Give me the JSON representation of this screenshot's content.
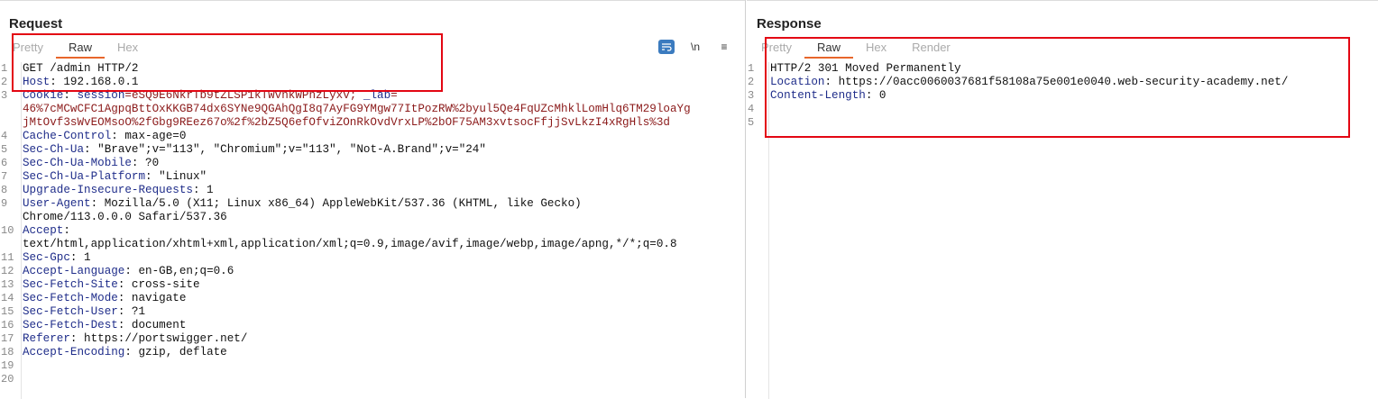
{
  "request": {
    "title": "Request",
    "tabs": [
      "Pretty",
      "Raw",
      "Hex"
    ],
    "active_tab": "Raw",
    "toolbar": [
      {
        "icon": "wrap-lines-icon",
        "glyph": "≡"
      },
      {
        "icon": "newline-icon",
        "glyph": "\\n"
      },
      {
        "icon": "menu-icon",
        "glyph": "≡"
      }
    ],
    "lines": [
      {
        "n": "1",
        "rows": [
          [
            {
              "t": "GET /admin HTTP/2",
              "c": ""
            }
          ]
        ]
      },
      {
        "n": "2",
        "rows": [
          [
            {
              "t": "Host",
              "c": "hdr"
            },
            {
              "t": ": 192.168.0.1",
              "c": ""
            }
          ]
        ]
      },
      {
        "n": "3",
        "rows": [
          [
            {
              "t": "Cookie",
              "c": "hdr"
            },
            {
              "t": ": ",
              "c": ""
            },
            {
              "t": "session",
              "c": "hdr"
            },
            {
              "t": "=eSQ9E6NkrTb9tZLSP1kTWvnkWPnzLyxv; ",
              "c": "cookie"
            },
            {
              "t": "_lab",
              "c": "hdr"
            },
            {
              "t": "=",
              "c": "cookie"
            }
          ],
          [
            {
              "t": "46%7cMCwCFC1AgpqBttOxKKGB74dx6SYNe9QGAhQgI8q7AyFG9YMgw77ItPozRW%2byul5Qe4FqUZcMhklLomHlq6TM29loaYg",
              "c": "cookie"
            }
          ],
          [
            {
              "t": "jMtOvf3sWvEOMsoO%2fGbg9REez67o%2f%2bZ5Q6efOfviZOnRkOvdVrxLP%2bOF75AM3xvtsocFfjjSvLkzI4xRgHls%3d",
              "c": "cookie"
            }
          ]
        ]
      },
      {
        "n": "4",
        "rows": [
          [
            {
              "t": "Cache-Control",
              "c": "hdr"
            },
            {
              "t": ": max-age=0",
              "c": ""
            }
          ]
        ]
      },
      {
        "n": "5",
        "rows": [
          [
            {
              "t": "Sec-Ch-Ua",
              "c": "hdr"
            },
            {
              "t": ": \"Brave\";v=\"113\", \"Chromium\";v=\"113\", \"Not-A.Brand\";v=\"24\"",
              "c": ""
            }
          ]
        ]
      },
      {
        "n": "6",
        "rows": [
          [
            {
              "t": "Sec-Ch-Ua-Mobile",
              "c": "hdr"
            },
            {
              "t": ": ?0",
              "c": ""
            }
          ]
        ]
      },
      {
        "n": "7",
        "rows": [
          [
            {
              "t": "Sec-Ch-Ua-Platform",
              "c": "hdr"
            },
            {
              "t": ": \"Linux\"",
              "c": ""
            }
          ]
        ]
      },
      {
        "n": "8",
        "rows": [
          [
            {
              "t": "Upgrade-Insecure-Requests",
              "c": "hdr"
            },
            {
              "t": ": 1",
              "c": ""
            }
          ]
        ]
      },
      {
        "n": "9",
        "rows": [
          [
            {
              "t": "User-Agent",
              "c": "hdr"
            },
            {
              "t": ": Mozilla/5.0 (X11; Linux x86_64) AppleWebKit/537.36 (KHTML, like Gecko)",
              "c": ""
            }
          ],
          [
            {
              "t": "Chrome/113.0.0.0 Safari/537.36",
              "c": ""
            }
          ]
        ]
      },
      {
        "n": "10",
        "rows": [
          [
            {
              "t": "Accept",
              "c": "hdr"
            },
            {
              "t": ":",
              "c": ""
            }
          ],
          [
            {
              "t": "text/html,application/xhtml+xml,application/xml;q=0.9,image/avif,image/webp,image/apng,*/*;q=0.8",
              "c": ""
            }
          ]
        ]
      },
      {
        "n": "11",
        "rows": [
          [
            {
              "t": "Sec-Gpc",
              "c": "hdr"
            },
            {
              "t": ": 1",
              "c": ""
            }
          ]
        ]
      },
      {
        "n": "12",
        "rows": [
          [
            {
              "t": "Accept-Language",
              "c": "hdr"
            },
            {
              "t": ": en-GB,en;q=0.6",
              "c": ""
            }
          ]
        ]
      },
      {
        "n": "13",
        "rows": [
          [
            {
              "t": "Sec-Fetch-Site",
              "c": "hdr"
            },
            {
              "t": ": cross-site",
              "c": ""
            }
          ]
        ]
      },
      {
        "n": "14",
        "rows": [
          [
            {
              "t": "Sec-Fetch-Mode",
              "c": "hdr"
            },
            {
              "t": ": navigate",
              "c": ""
            }
          ]
        ]
      },
      {
        "n": "15",
        "rows": [
          [
            {
              "t": "Sec-Fetch-User",
              "c": "hdr"
            },
            {
              "t": ": ?1",
              "c": ""
            }
          ]
        ]
      },
      {
        "n": "16",
        "rows": [
          [
            {
              "t": "Sec-Fetch-Dest",
              "c": "hdr"
            },
            {
              "t": ": document",
              "c": ""
            }
          ]
        ]
      },
      {
        "n": "17",
        "rows": [
          [
            {
              "t": "Referer",
              "c": "hdr"
            },
            {
              "t": ": https://portswigger.net/",
              "c": ""
            }
          ]
        ]
      },
      {
        "n": "18",
        "rows": [
          [
            {
              "t": "Accept-Encoding",
              "c": "hdr"
            },
            {
              "t": ": gzip, deflate",
              "c": ""
            }
          ]
        ]
      },
      {
        "n": "19",
        "rows": [
          []
        ]
      },
      {
        "n": "20",
        "rows": [
          []
        ]
      }
    ]
  },
  "response": {
    "title": "Response",
    "tabs": [
      "Pretty",
      "Raw",
      "Hex",
      "Render"
    ],
    "active_tab": "Raw",
    "lines": [
      {
        "n": "1",
        "rows": [
          [
            {
              "t": "HTTP/2 301 Moved Permanently",
              "c": ""
            }
          ]
        ]
      },
      {
        "n": "2",
        "rows": [
          [
            {
              "t": "Location",
              "c": "hdr"
            },
            {
              "t": ": https://0acc0060037681f58108a75e001e0040.web-security-academy.net/",
              "c": ""
            }
          ]
        ]
      },
      {
        "n": "3",
        "rows": [
          [
            {
              "t": "Content-Length",
              "c": "hdr"
            },
            {
              "t": ": 0",
              "c": ""
            }
          ]
        ]
      },
      {
        "n": "4",
        "rows": [
          []
        ]
      },
      {
        "n": "5",
        "rows": [
          []
        ]
      }
    ]
  },
  "colors": {
    "highlight_box": "#e30613",
    "tab_underline": "#e8662b",
    "header_name": "#1f2d8a",
    "cookie_value": "#8b1a1a"
  }
}
